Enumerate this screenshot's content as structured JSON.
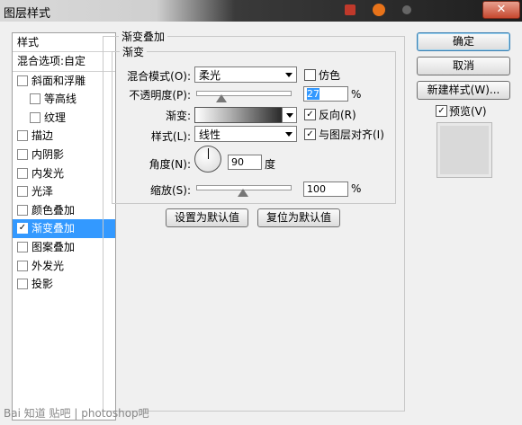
{
  "window": {
    "title": "图层样式",
    "close_label": "✕"
  },
  "left_panel": {
    "header": "样式",
    "items": [
      {
        "label": "混合选项:自定",
        "checkbox": false,
        "checked": false,
        "indent": 0,
        "selected": false
      },
      {
        "label": "斜面和浮雕",
        "checkbox": true,
        "checked": false,
        "indent": 0,
        "selected": false
      },
      {
        "label": "等高线",
        "checkbox": true,
        "checked": false,
        "indent": 1,
        "selected": false
      },
      {
        "label": "纹理",
        "checkbox": true,
        "checked": false,
        "indent": 1,
        "selected": false
      },
      {
        "label": "描边",
        "checkbox": true,
        "checked": false,
        "indent": 0,
        "selected": false
      },
      {
        "label": "内阴影",
        "checkbox": true,
        "checked": false,
        "indent": 0,
        "selected": false
      },
      {
        "label": "内发光",
        "checkbox": true,
        "checked": false,
        "indent": 0,
        "selected": false
      },
      {
        "label": "光泽",
        "checkbox": true,
        "checked": false,
        "indent": 0,
        "selected": false
      },
      {
        "label": "颜色叠加",
        "checkbox": true,
        "checked": false,
        "indent": 0,
        "selected": false
      },
      {
        "label": "渐变叠加",
        "checkbox": true,
        "checked": true,
        "indent": 0,
        "selected": true
      },
      {
        "label": "图案叠加",
        "checkbox": true,
        "checked": false,
        "indent": 0,
        "selected": false
      },
      {
        "label": "外发光",
        "checkbox": true,
        "checked": false,
        "indent": 0,
        "selected": false
      },
      {
        "label": "投影",
        "checkbox": true,
        "checked": false,
        "indent": 0,
        "selected": false
      }
    ]
  },
  "panel": {
    "outer_title": "渐变叠加",
    "inner_title": "渐变",
    "blend_mode": {
      "label": "混合模式(O):",
      "value": "柔光"
    },
    "dither": {
      "label": "仿色",
      "checked": false
    },
    "opacity": {
      "label": "不透明度(P):",
      "value": "27",
      "unit": "%",
      "slider_fraction": 0.27
    },
    "gradient": {
      "label": "渐变:"
    },
    "reverse": {
      "label": "反向(R)",
      "checked": true
    },
    "style": {
      "label": "样式(L):",
      "value": "线性"
    },
    "align_layer": {
      "label": "与图层对齐(I)",
      "checked": true
    },
    "angle": {
      "label": "角度(N):",
      "value": "90",
      "unit": "度",
      "degrees": 90
    },
    "scale": {
      "label": "缩放(S):",
      "value": "100",
      "unit": "%",
      "slider_fraction": 0.5
    },
    "make_default_label": "设置为默认值",
    "reset_default_label": "复位为默认值"
  },
  "right_buttons": {
    "ok_label": "确定",
    "cancel_label": "取消",
    "new_style_label": "新建样式(W)...",
    "preview_label": "预览(V)",
    "preview_checked": true
  },
  "watermark": "Bai 知道 贴吧 | photoshop吧",
  "check_glyph": "✓"
}
